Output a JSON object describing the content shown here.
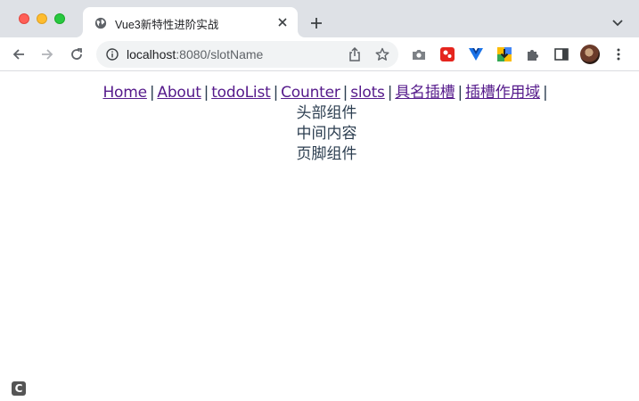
{
  "tab": {
    "title": "Vue3新特性进阶实战",
    "icon": "globe-icon"
  },
  "toolbar": {
    "url_host": "localhost",
    "url_path": ":8080/slotName",
    "back_icon": "arrow-left-icon",
    "forward_icon": "arrow-right-icon",
    "reload_icon": "reload-icon"
  },
  "nav": {
    "separator": "|",
    "links": [
      {
        "label": "Home"
      },
      {
        "label": "About"
      },
      {
        "label": "todoList"
      },
      {
        "label": "Counter"
      },
      {
        "label": "slots"
      },
      {
        "label": "具名插槽"
      },
      {
        "label": "插槽作用域"
      }
    ]
  },
  "content": {
    "header": "头部组件",
    "main": "中间内容",
    "footer": "页脚组件"
  },
  "colors": {
    "link": "#2c3e50",
    "visited_link": "#551a8b",
    "tabstrip": "#dee1e6",
    "omnibox": "#f1f3f4"
  }
}
